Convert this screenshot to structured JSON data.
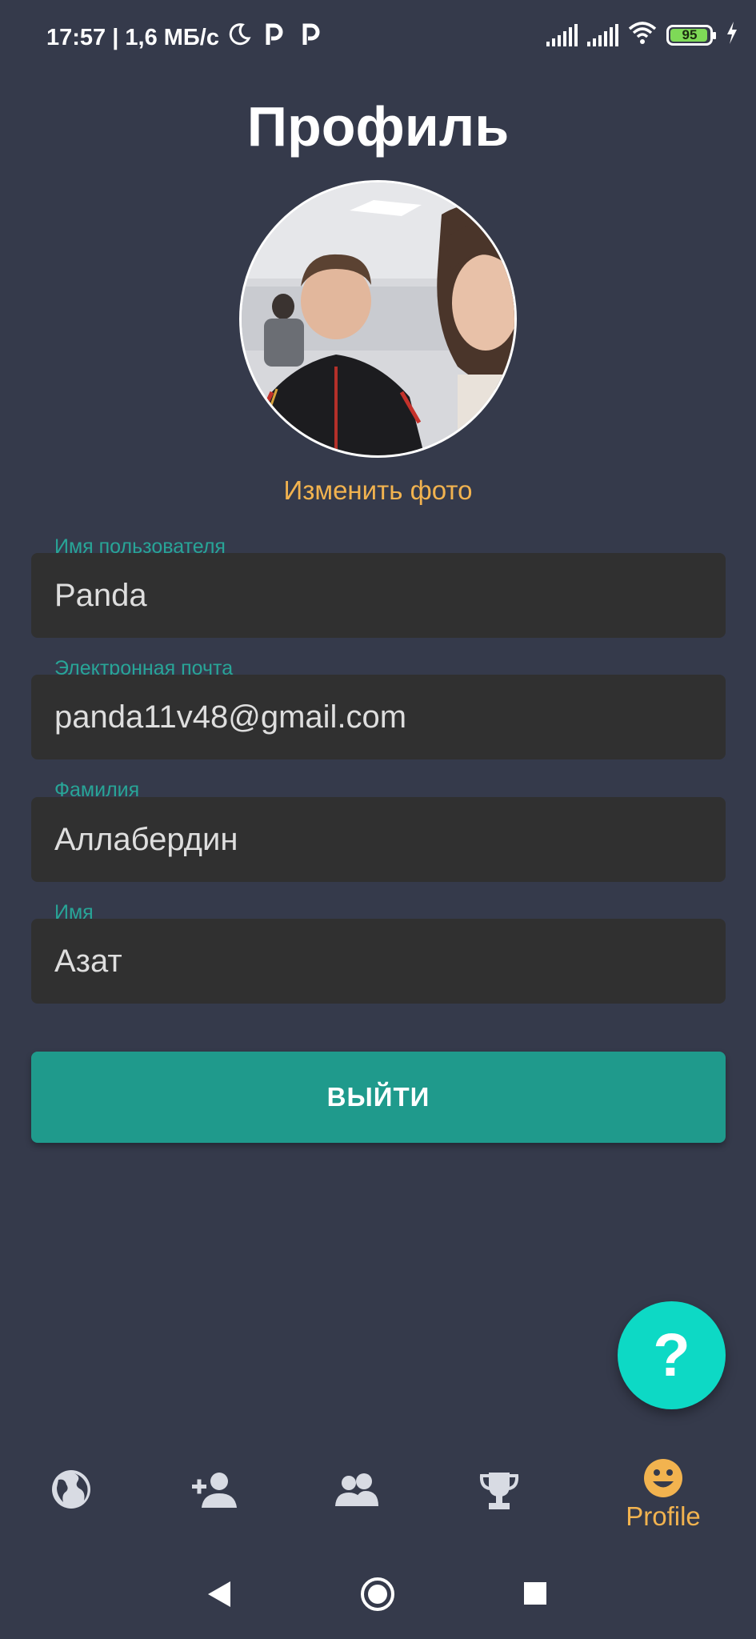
{
  "status_bar": {
    "time_speed": "17:57 | 1,6 МБ/с",
    "battery": "95",
    "icons": [
      "moon-icon",
      "p-app-icon",
      "p-app-icon",
      "signal-icon",
      "signal-icon",
      "wifi-icon",
      "battery-icon",
      "charging-icon"
    ]
  },
  "header": {
    "title": "Профиль"
  },
  "avatar": {
    "change_photo_label": "Изменить фото"
  },
  "fields": [
    {
      "label": "Имя пользователя",
      "value": "Panda"
    },
    {
      "label": "Электронная почта",
      "value": "panda11v48@gmail.com"
    },
    {
      "label": "Фамилия",
      "value": "Аллабердин"
    },
    {
      "label": "Имя",
      "value": "Азат"
    }
  ],
  "logout": {
    "label": "ВЫЙТИ"
  },
  "fab": {
    "label": "?"
  },
  "bottom_nav": {
    "items": [
      {
        "icon": "globe-icon",
        "label": ""
      },
      {
        "icon": "add-person-icon",
        "label": ""
      },
      {
        "icon": "group-icon",
        "label": ""
      },
      {
        "icon": "trophy-icon",
        "label": ""
      },
      {
        "icon": "smiley-icon",
        "label": "Profile",
        "active": true
      }
    ]
  },
  "colors": {
    "background": "#353a4b",
    "field_bg": "#303030",
    "accent_teal": "#28a597",
    "button_teal": "#1f9a8c",
    "fab": "#0dd9c5",
    "accent_orange": "#f2b34f",
    "nav_icon": "#d8dbe3"
  }
}
